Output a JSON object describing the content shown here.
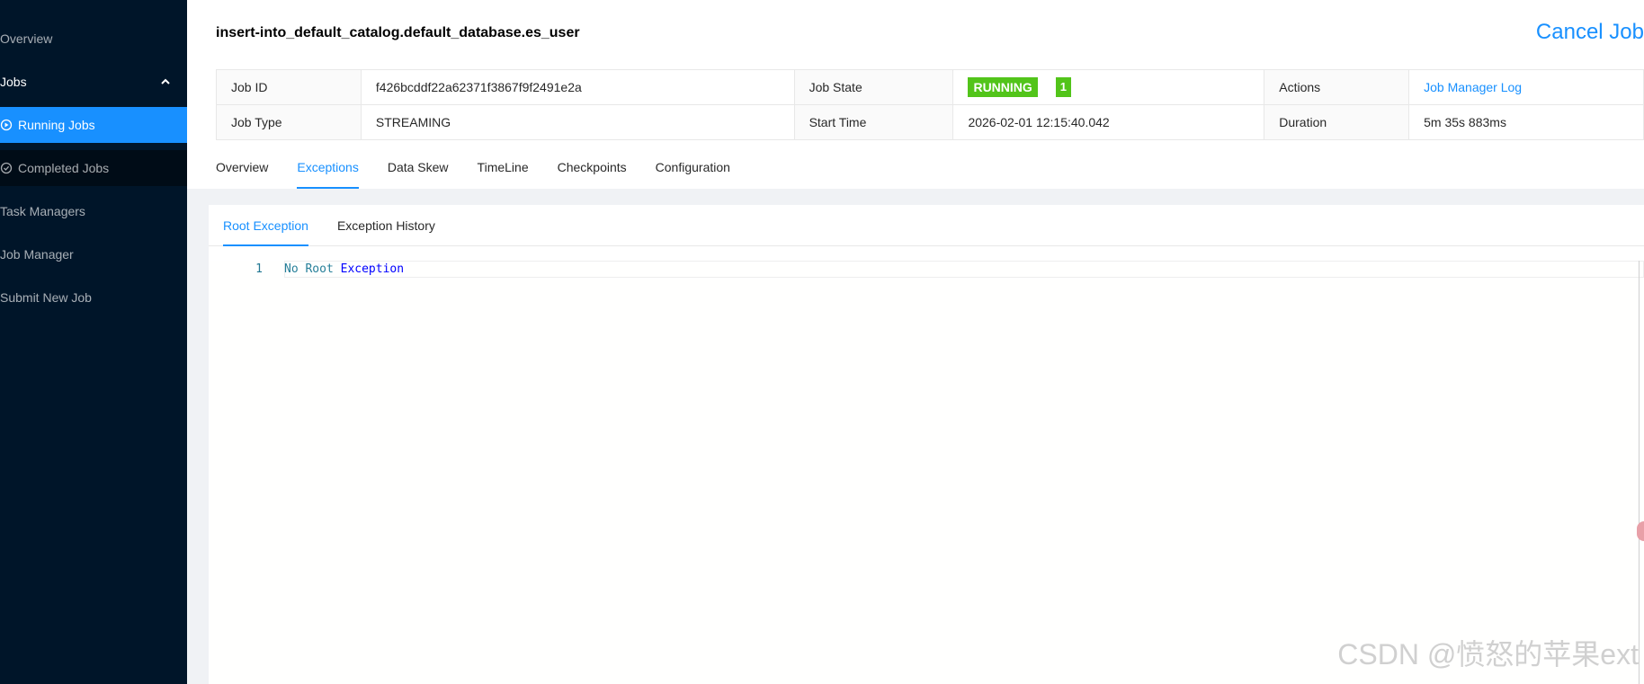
{
  "sidebar": {
    "items": [
      {
        "label": "Overview"
      },
      {
        "label": "Jobs"
      },
      {
        "label": "Running Jobs"
      },
      {
        "label": "Completed Jobs"
      },
      {
        "label": "Task Managers"
      },
      {
        "label": "Job Manager"
      },
      {
        "label": "Submit New Job"
      }
    ]
  },
  "header": {
    "title": "insert-into_default_catalog.default_database.es_user",
    "cancel_label": "Cancel Job"
  },
  "details": {
    "job_id_label": "Job ID",
    "job_id": "f426bcddf22a62371f3867f9f2491e2a",
    "job_state_label": "Job State",
    "job_state": "RUNNING",
    "job_state_count": "1",
    "actions_label": "Actions",
    "actions_link": "Job Manager Log",
    "job_type_label": "Job Type",
    "job_type": "STREAMING",
    "start_time_label": "Start Time",
    "start_time": "2026-02-01 12:15:40.042",
    "duration_label": "Duration",
    "duration": "5m 35s 883ms"
  },
  "tabs": [
    {
      "label": "Overview"
    },
    {
      "label": "Exceptions"
    },
    {
      "label": "Data Skew"
    },
    {
      "label": "TimeLine"
    },
    {
      "label": "Checkpoints"
    },
    {
      "label": "Configuration"
    }
  ],
  "subtabs": [
    {
      "label": "Root Exception"
    },
    {
      "label": "Exception History"
    }
  ],
  "editor": {
    "line_number": "1",
    "token_1": "No Root",
    "token_2": "Exception"
  },
  "watermark": "CSDN @愤怒的苹果ext",
  "colors": {
    "sidebar_bg": "#001529",
    "accent": "#1890ff",
    "running": "#52c41a"
  }
}
